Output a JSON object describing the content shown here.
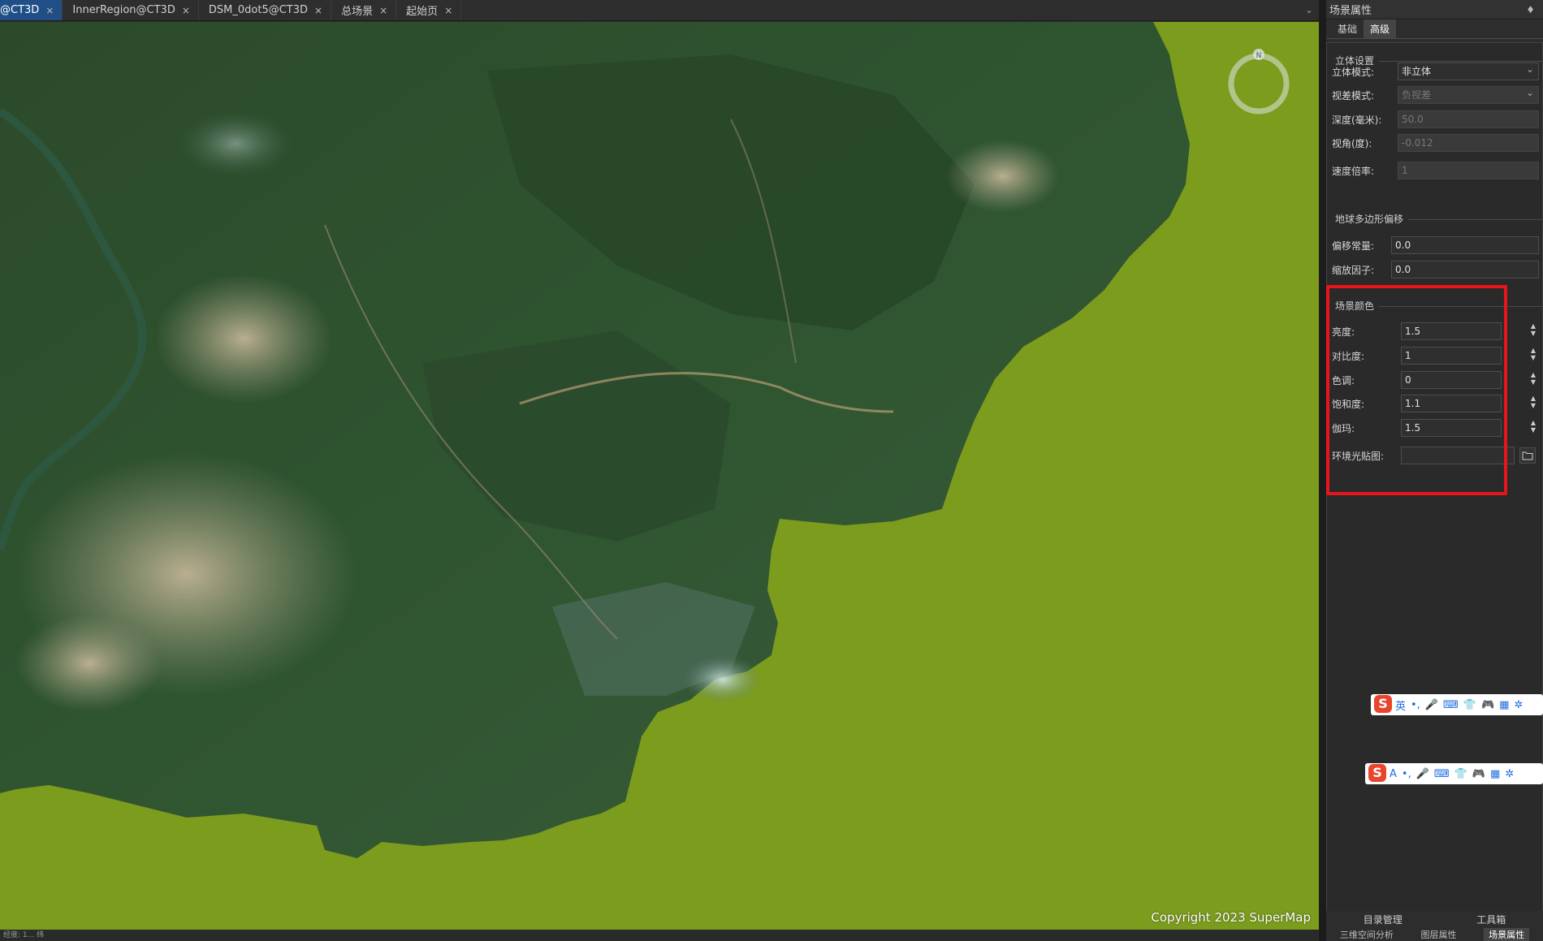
{
  "tabs": [
    {
      "label": "@CT3D"
    },
    {
      "label": "InnerRegion@CT3D"
    },
    {
      "label": "DSM_0dot5@CT3D"
    },
    {
      "label": "总场景"
    },
    {
      "label": "起始页"
    }
  ],
  "tab_close_glyph": "×",
  "viewport": {
    "copyright": "Copyright 2023 SuperMap",
    "compass_label": "N",
    "status_text": "经度: 1... 纬"
  },
  "panel": {
    "title": "场景属性",
    "pin_glyph": "♦",
    "subtabs": [
      "基础",
      "高级"
    ],
    "stereo": {
      "title": "立体设置",
      "mode_label": "立体模式:",
      "mode_value": "非立体",
      "parallax_label": "视差模式:",
      "parallax_value": "负视差",
      "depth_label": "深度(毫米):",
      "depth_value": "50.0",
      "angle_label": "视角(度):",
      "angle_value": "-0.012",
      "speed_label": "速度倍率:",
      "speed_value": "1"
    },
    "polygon_offset": {
      "title": "地球多边形偏移",
      "offset_label": "偏移常量:",
      "offset_value": "0.0",
      "scale_label": "缩放因子:",
      "scale_value": "0.0"
    },
    "scene_color": {
      "title": "场景颜色",
      "brightness_label": "亮度:",
      "brightness_value": "1.5",
      "contrast_label": "对比度:",
      "contrast_value": "1",
      "hue_label": "色调:",
      "hue_value": "0",
      "saturation_label": "饱和度:",
      "saturation_value": "1.1",
      "gamma_label": "伽玛:",
      "gamma_value": "1.5",
      "envmap_label": "环境光贴图:",
      "envmap_value": ""
    }
  },
  "ime_bar_1": {
    "logo": "S",
    "items": [
      "英",
      "•,",
      "🎤",
      "⌨",
      "👕",
      "🎮",
      "▦",
      "✲"
    ]
  },
  "ime_bar_2": {
    "logo": "S",
    "items": [
      "A",
      "•,",
      "🎤",
      "⌨",
      "👕",
      "🎮",
      "▦",
      "✲"
    ]
  },
  "bottom_tabs_row1": [
    "目录管理",
    "工具箱"
  ],
  "bottom_tabs_row2": [
    "三维空间分析",
    "图层属性",
    "场景属性"
  ],
  "colors": {
    "highlight": "#e8141e",
    "ocean": "#7c9c1d",
    "forest": "#2f4f2a"
  }
}
